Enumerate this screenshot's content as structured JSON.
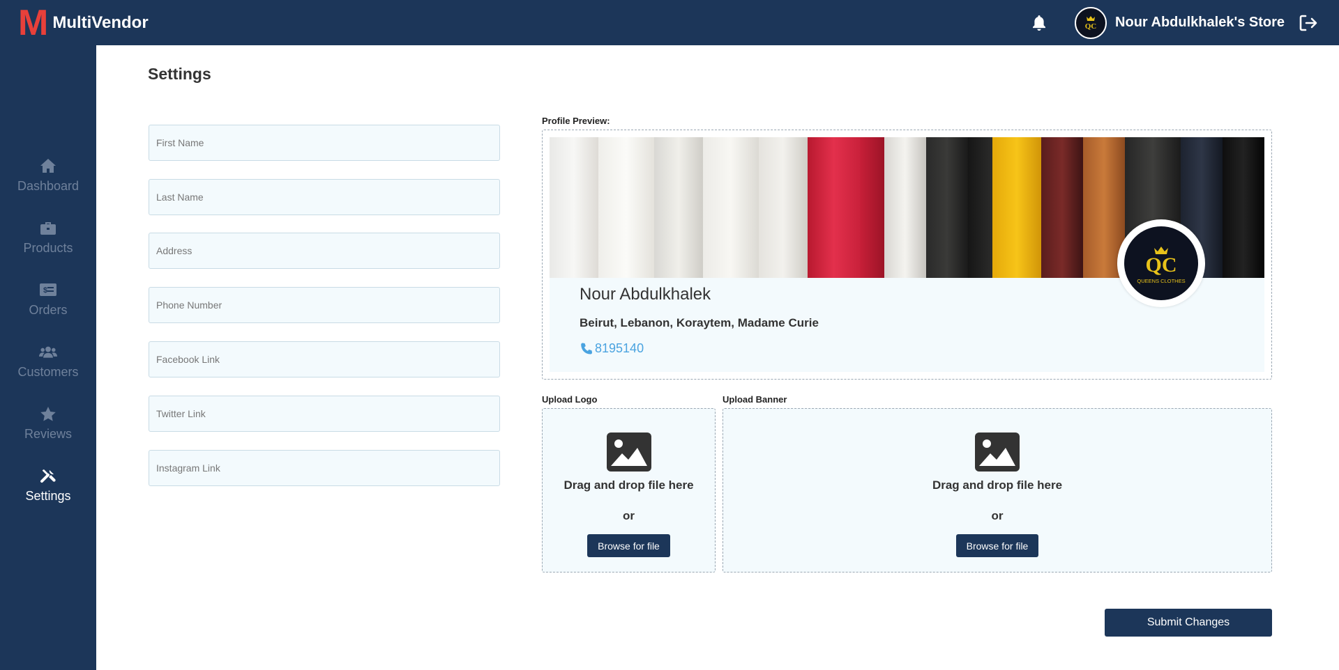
{
  "app": {
    "logo_letter": "M",
    "name": "MultiVendor"
  },
  "header": {
    "store_name": "Nour Abdulkhalek's Store",
    "store_avatar_text": "QC"
  },
  "sidebar": {
    "items": [
      {
        "label": "Dashboard",
        "icon": "home-icon",
        "active": false
      },
      {
        "label": "Products",
        "icon": "briefcase-icon",
        "active": false
      },
      {
        "label": "Orders",
        "icon": "receipt-icon",
        "active": false
      },
      {
        "label": "Customers",
        "icon": "users-icon",
        "active": false
      },
      {
        "label": "Reviews",
        "icon": "star-icon",
        "active": false
      },
      {
        "label": "Settings",
        "icon": "tools-icon",
        "active": true
      }
    ]
  },
  "page": {
    "title": "Settings"
  },
  "form": {
    "first_name": {
      "placeholder": "First Name",
      "value": ""
    },
    "last_name": {
      "placeholder": "Last Name",
      "value": ""
    },
    "address": {
      "placeholder": "Address",
      "value": ""
    },
    "phone": {
      "placeholder": "Phone Number",
      "value": ""
    },
    "facebook": {
      "placeholder": "Facebook Link",
      "value": ""
    },
    "twitter": {
      "placeholder": "Twitter Link",
      "value": ""
    },
    "instagram": {
      "placeholder": "Instagram Link",
      "value": ""
    }
  },
  "preview": {
    "label": "Profile Preview:",
    "name": "Nour Abdulkhalek",
    "address": "Beirut, Lebanon, Koraytem, Madame Curie",
    "phone": "8195140",
    "logo_text": "QUEENS CLOTHES",
    "logo_monogram": "QC"
  },
  "upload_logo": {
    "label": "Upload Logo",
    "drag_text": "Drag and drop file here",
    "or_text": "or",
    "button": "Browse for file"
  },
  "upload_banner": {
    "label": "Upload Banner",
    "drag_text": "Drag and drop file here",
    "or_text": "or",
    "button": "Browse for file"
  },
  "submit": {
    "label": "Submit Changes"
  },
  "colors": {
    "primary": "#1c3659",
    "accent_red": "#e8403a",
    "field_bg": "#f3fafd",
    "phone_blue": "#4aa3e0",
    "gold": "#e8c21a"
  }
}
